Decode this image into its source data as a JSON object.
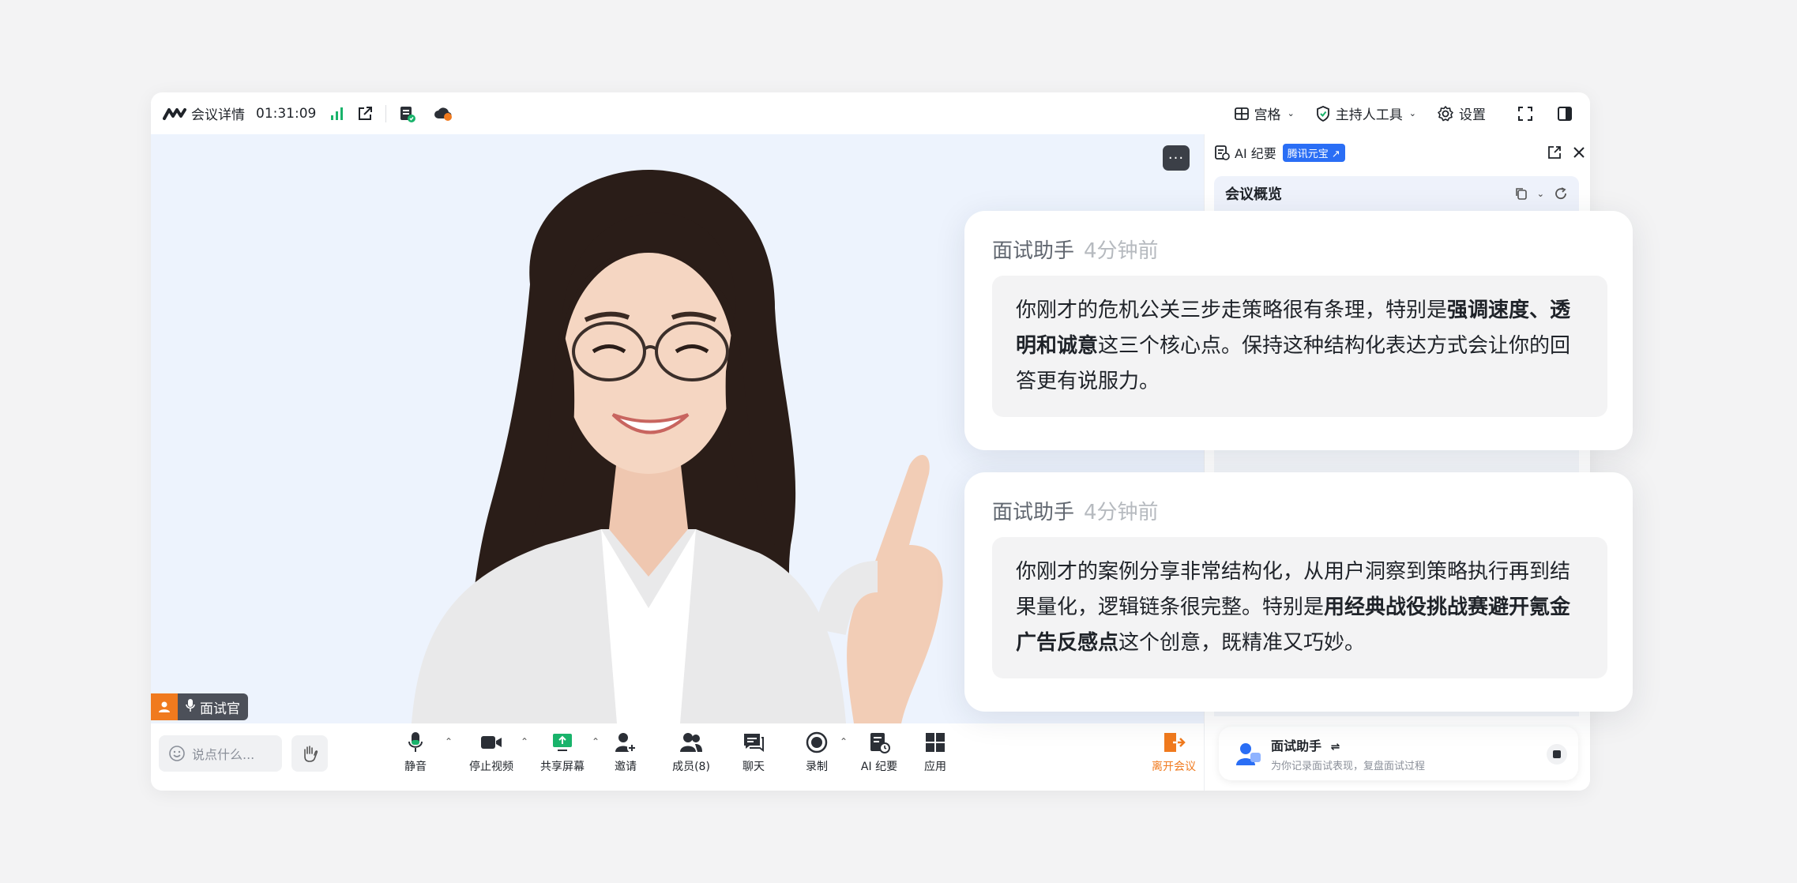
{
  "topbar": {
    "meeting_details": "会议详情",
    "elapsed_time": "01:31:09",
    "grid_label": "宫格",
    "host_tools_label": "主持人工具",
    "settings_label": "设置"
  },
  "stage": {
    "speaker_name": "面试官",
    "more_label": "···"
  },
  "panel": {
    "title": "AI 纪要",
    "badge": "腾讯元宝 ↗",
    "overview": "会议概览",
    "assistant_title": "面试助手",
    "assistant_sub": "为你记录面试表现，复盘面试过程"
  },
  "toolbar": {
    "say_placeholder": "说点什么...",
    "items": [
      {
        "label": "静音"
      },
      {
        "label": "停止视频"
      },
      {
        "label": "共享屏幕"
      },
      {
        "label": "邀请"
      },
      {
        "label": "成员(8)"
      },
      {
        "label": "聊天"
      },
      {
        "label": "录制"
      },
      {
        "label": "AI 纪要"
      },
      {
        "label": "应用"
      }
    ],
    "leave_label": "离开会议"
  },
  "cards": [
    {
      "sender": "面试助手",
      "time": "4分钟前",
      "text_pre": "你刚才的危机公关三步走策略很有条理，特别是",
      "text_bold": "强调速度、透明和诚意",
      "text_post": "这三个核心点。保持这种结构化表达方式会让你的回答更有说服力。"
    },
    {
      "sender": "面试助手",
      "time": "4分钟前",
      "text_pre": "你刚才的案例分享非常结构化，从用户洞察到策略执行再到结果量化，逻辑链条很完整。特别是",
      "text_bold": "用经典战役挑战赛避开氪金广告反感点",
      "text_post": "这个创意，既精准又巧妙。"
    }
  ],
  "colors": {
    "accent_orange": "#f07a1e",
    "brand_blue": "#2a6ef5",
    "signal_green": "#19b36b",
    "stage_bg": "#edf3fd"
  }
}
